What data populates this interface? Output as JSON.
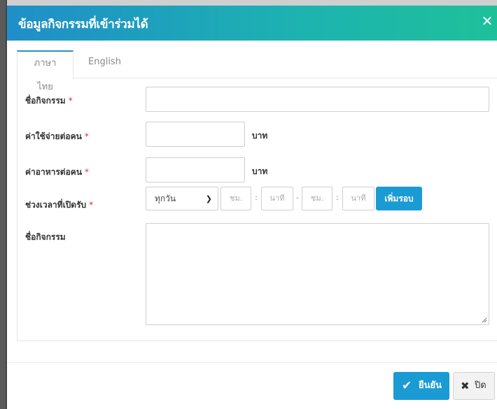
{
  "modal": {
    "title": "ข้อมูลกิจกรรมที่เข้าร่วมได้",
    "close_icon": "close-icon"
  },
  "tabs": [
    {
      "label": "ภาษาไทย",
      "active": true
    },
    {
      "label": "English",
      "active": false
    }
  ],
  "form": {
    "activity_name": {
      "label": "ชื่อกิจกรรม",
      "required_mark": "*",
      "value": ""
    },
    "cost_per_person": {
      "label": "ค่าใช้จ่ายต่อคน",
      "required_mark": "*",
      "value": "",
      "unit": "บาท"
    },
    "food_cost_per_person": {
      "label": "ค่าอาหารต่อคน",
      "required_mark": "*",
      "value": "",
      "unit": "บาท"
    },
    "open_period": {
      "label": "ช่วงเวลาที่เปิดรับ",
      "required_mark": "*",
      "day_select": "ทุกวัน",
      "start_hour_placeholder": "ชม.",
      "start_minute_placeholder": "นาที",
      "end_hour_placeholder": "ชม.",
      "end_minute_placeholder": "นาที",
      "colon": ":",
      "dash": "-",
      "add_round_label": "เพิ่มรอบ"
    },
    "description": {
      "label": "ชื่อกิจกรรม",
      "value": ""
    }
  },
  "footer": {
    "confirm_label": "ยืนยัน",
    "close_label": "ปิด"
  },
  "colors": {
    "header_start": "#1f8ec9",
    "header_end": "#1ec09a",
    "primary_button": "#1a9bd4",
    "required": "#d9302c"
  }
}
